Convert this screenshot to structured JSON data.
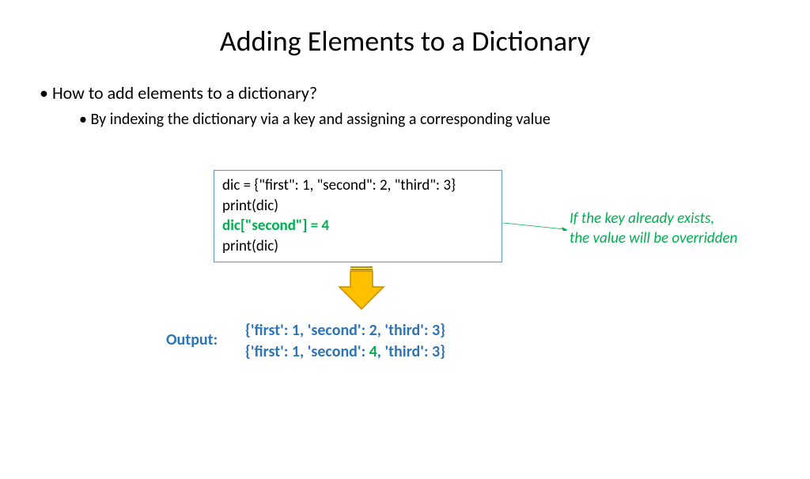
{
  "title": "Adding Elements to a Dictionary",
  "bullets": {
    "main": "How to add elements to a dictionary?",
    "sub": "By indexing the dictionary via a key and assigning a corresponding value"
  },
  "code": {
    "line1": "dic = {\"first\": 1, \"second\": 2, \"third\": 3}",
    "line2": "print(dic)",
    "line3": "dic[\"second\"] = 4",
    "line4": "print(dic)"
  },
  "annotation": {
    "line1": "If the key already exists,",
    "line2": "the value will be overridden"
  },
  "output": {
    "label": "Output:",
    "line1": "{'first': 1, 'second': 2, 'third': 3}",
    "line2_pre": "{'first': 1, 'second':",
    "line2_val": " 4",
    "line2_post": ", 'third': 3}"
  }
}
